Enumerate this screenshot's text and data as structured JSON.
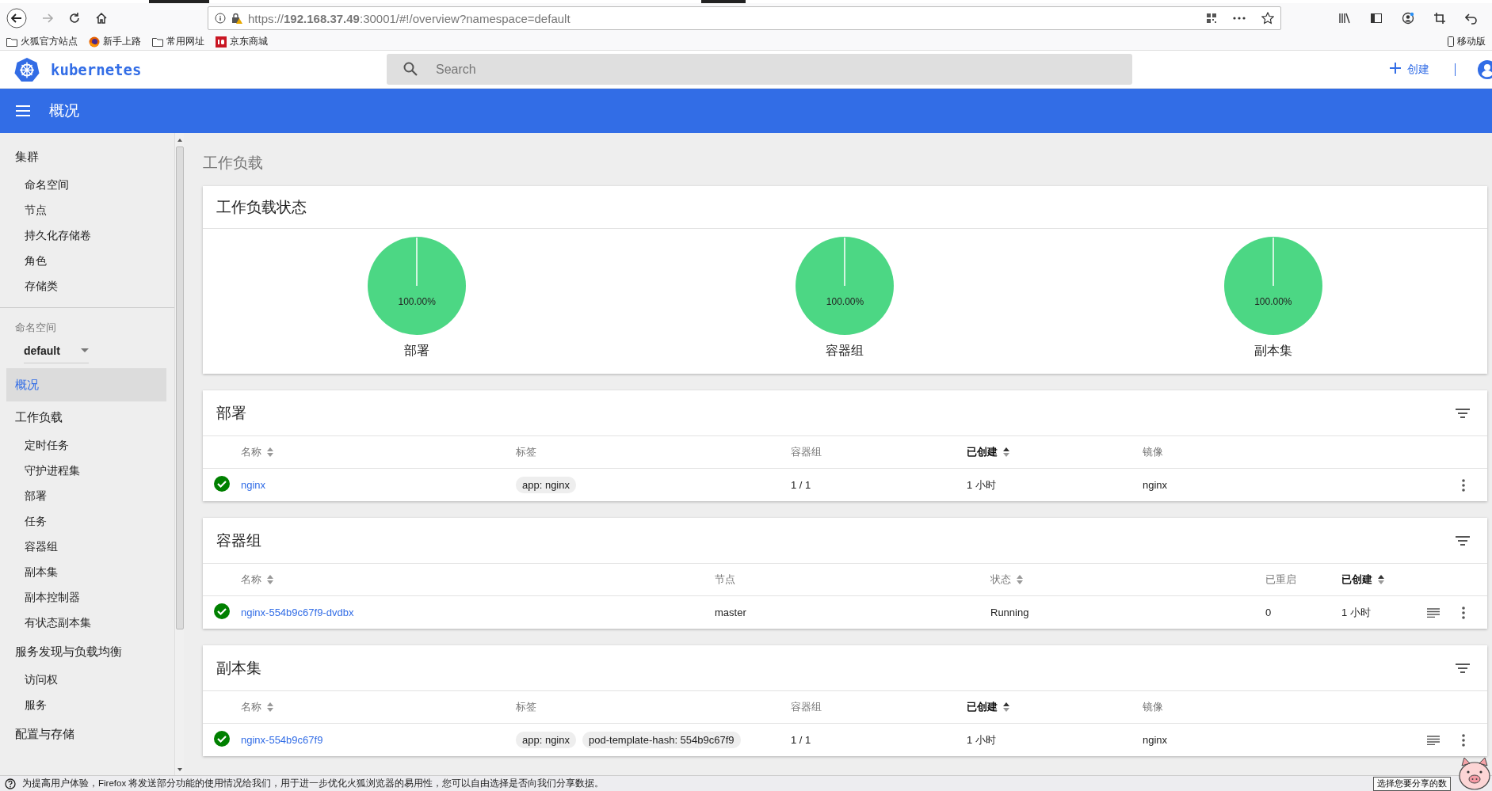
{
  "browser": {
    "url": "https://**192.168.37.49**:30001/#!/overview?namespace=default",
    "bookmarks": [
      {
        "kind": "folder",
        "label": "火狐官方站点"
      },
      {
        "kind": "firefox",
        "label": "新手上路"
      },
      {
        "kind": "folder",
        "label": "常用网址"
      },
      {
        "kind": "jd",
        "label": "京东商城"
      }
    ],
    "mobile_bookmarks": "移动版"
  },
  "header": {
    "logo": "kubernetes",
    "search": {
      "placeholder": "Search"
    },
    "create": "创建"
  },
  "toolbar": {
    "title": "概况"
  },
  "sidebar": {
    "cluster": {
      "label": "集群",
      "children": [
        {
          "label": "命名空间",
          "selected": false
        },
        {
          "label": "节点",
          "selected": false
        },
        {
          "label": "持久化存储卷",
          "selected": false
        },
        {
          "label": "角色",
          "selected": false
        },
        {
          "label": "存储类",
          "selected": false
        }
      ]
    },
    "namespace": {
      "label": "命名空间",
      "value": "default"
    },
    "nav": [
      {
        "label": "概况",
        "selected": true
      },
      {
        "label": "工作负载",
        "selected": false,
        "children": [
          {
            "label": "定时任务",
            "selected": false
          },
          {
            "label": "守护进程集",
            "selected": false
          },
          {
            "label": "部署",
            "selected": false
          },
          {
            "label": "任务",
            "selected": false
          },
          {
            "label": "容器组",
            "selected": false
          },
          {
            "label": "副本集",
            "selected": false
          },
          {
            "label": "副本控制器",
            "selected": false
          },
          {
            "label": "有状态副本集",
            "selected": false
          }
        ]
      },
      {
        "label": "服务发现与负载均衡",
        "selected": false,
        "children": [
          {
            "label": "访问权",
            "selected": false
          },
          {
            "label": "服务",
            "selected": false
          }
        ]
      },
      {
        "label": "配置与存储",
        "selected": false
      }
    ]
  },
  "page_title": "工作负载",
  "status_card": {
    "title": "工作负载状态",
    "charts": [
      {
        "label": "部署",
        "chart_data": {
          "type": "pie",
          "values": [
            100
          ],
          "value_labels": [
            "100.00%"
          ]
        }
      },
      {
        "label": "容器组",
        "chart_data": {
          "type": "pie",
          "values": [
            100
          ],
          "value_labels": [
            "100.00%"
          ]
        }
      },
      {
        "label": "副本集",
        "chart_data": {
          "type": "pie",
          "values": [
            100
          ],
          "value_labels": [
            "100.00%"
          ]
        }
      }
    ]
  },
  "tables": [
    {
      "kind": "deployment",
      "title": "部署",
      "columns": [
        {
          "label": "名称",
          "sortable": true,
          "active": false
        },
        {
          "label": "标签",
          "sortable": false,
          "active": false
        },
        {
          "label": "容器组",
          "sortable": false,
          "active": false
        },
        {
          "label": "已创建",
          "sortable": true,
          "active": true
        },
        {
          "label": "镜像",
          "sortable": false,
          "active": false
        }
      ],
      "rows": [
        {
          "healthy": true,
          "logs": false,
          "cells": [
            {
              "kind": "link",
              "text": "nginx"
            },
            {
              "kind": "chips",
              "values": [
                "app: nginx"
              ]
            },
            {
              "kind": "text",
              "text": "1 / 1"
            },
            {
              "kind": "text",
              "text": "1 小时"
            },
            {
              "kind": "text",
              "text": "nginx"
            }
          ]
        }
      ]
    },
    {
      "kind": "pod",
      "title": "容器组",
      "columns": [
        {
          "label": "名称",
          "sortable": true,
          "active": false
        },
        {
          "label": "节点",
          "sortable": false,
          "active": false
        },
        {
          "label": "状态",
          "sortable": true,
          "active": false
        },
        {
          "label": "已重启",
          "sortable": false,
          "active": false
        },
        {
          "label": "已创建",
          "sortable": true,
          "active": true
        }
      ],
      "rows": [
        {
          "healthy": true,
          "logs": true,
          "cells": [
            {
              "kind": "link",
              "text": "nginx-554b9c67f9-dvdbx"
            },
            {
              "kind": "text",
              "text": "master"
            },
            {
              "kind": "text",
              "text": "Running"
            },
            {
              "kind": "text",
              "text": "0"
            },
            {
              "kind": "text",
              "text": "1 小时"
            }
          ]
        }
      ]
    },
    {
      "kind": "deployment",
      "title": "副本集",
      "columns": [
        {
          "label": "名称",
          "sortable": true,
          "active": false
        },
        {
          "label": "标签",
          "sortable": false,
          "active": false
        },
        {
          "label": "容器组",
          "sortable": false,
          "active": false
        },
        {
          "label": "已创建",
          "sortable": true,
          "active": true
        },
        {
          "label": "镜像",
          "sortable": false,
          "active": false
        }
      ],
      "rows": [
        {
          "healthy": true,
          "logs": true,
          "cells": [
            {
              "kind": "link",
              "text": "nginx-554b9c67f9"
            },
            {
              "kind": "chips",
              "values": [
                "app: nginx",
                "pod-template-hash: 554b9c67f9"
              ]
            },
            {
              "kind": "text",
              "text": "1 / 1"
            },
            {
              "kind": "text",
              "text": "1 小时"
            },
            {
              "kind": "text",
              "text": "nginx"
            }
          ]
        }
      ]
    }
  ],
  "notification": {
    "text": "为提高用户体验，Firefox 将发送部分功能的使用情况给我们，用于进一步优化火狐浏览器的易用性，您可以自由选择是否向我们分享数据。",
    "button": "选择您要分享的数"
  }
}
